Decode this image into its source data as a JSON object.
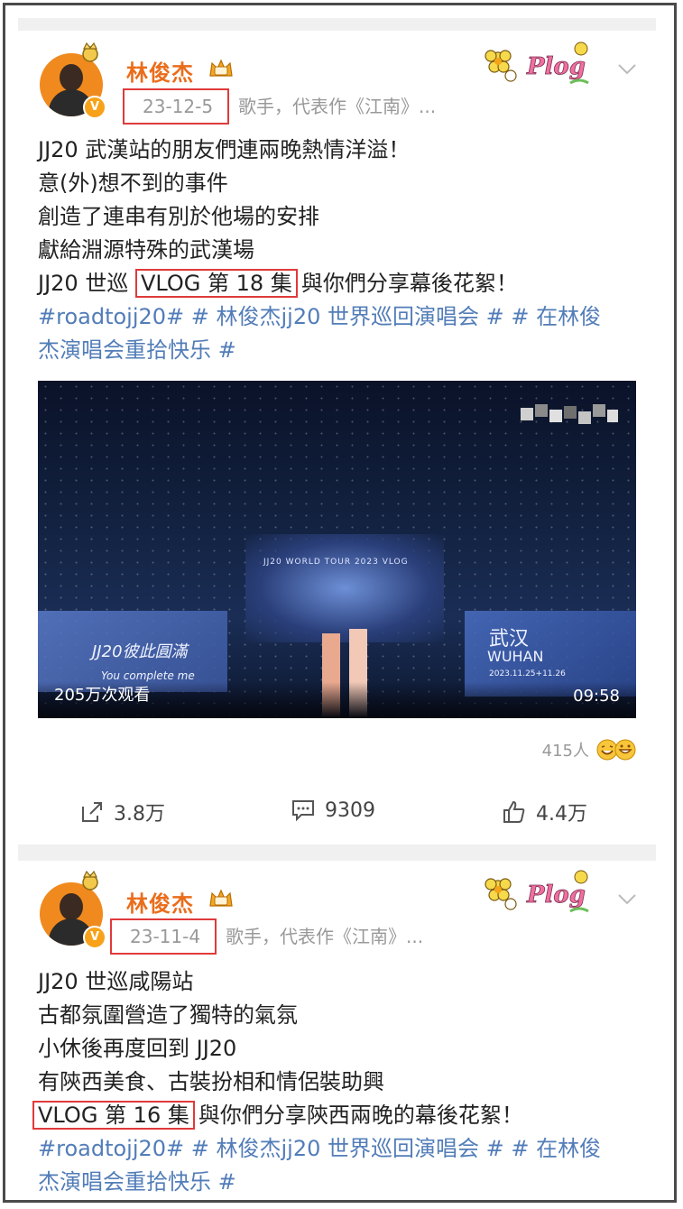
{
  "posts": [
    {
      "author": "林俊杰",
      "date": "23-12-5",
      "bio": "歌手，代表作《江南》...",
      "lines": [
        "JJ20 武漢站的朋友們連兩晚熱情洋溢！",
        "意(外)想不到的事件",
        "創造了連串有別於他場的安排",
        "獻給淵源特殊的武漢場"
      ],
      "vlog_prefix": "JJ20 世巡",
      "vlog_label": "VLOG 第 18 集",
      "vlog_suffix": "與你們分享幕後花絮！",
      "hashtags_line1": "#roadtojj20# # 林俊杰jj20 世界巡回演唱会 # # 在林俊",
      "hashtags_line2": "杰演唱会重拾快乐 #",
      "video": {
        "views": "205万次观看",
        "duration": "09:58",
        "stage_title": "JJ20 WORLD TOUR 2023 VLOG",
        "screen_left": "JJ20彼此圓滿",
        "screen_left_sub": "You complete me",
        "screen_right": "武汉",
        "screen_right_sub": "WUHAN",
        "screen_right_date": "2023.11.25+11.26"
      },
      "reactions_count": "415人",
      "share_count": "3.8万",
      "comment_count": "9309",
      "like_count": "4.4万"
    },
    {
      "author": "林俊杰",
      "date": "23-11-4",
      "bio": "歌手，代表作《江南》...",
      "lines": [
        "JJ20 世巡咸陽站",
        "古都氛圍營造了獨特的氣氛",
        "小休後再度回到 JJ20",
        "有陝西美食、古裝扮相和情侶裝助興"
      ],
      "vlog_label": "VLOG 第 16 集",
      "vlog_suffix": "與你們分享陝西兩晚的幕後花絮！",
      "hashtags_line1": "#roadtojj20# # 林俊杰jj20 世界巡回演唱会 # # 在林俊",
      "hashtags_line2": "杰演唱会重拾快乐 #"
    }
  ],
  "sticker_text": "Plog",
  "colors": {
    "name": "#ea6d1b",
    "hashtag": "#527db8",
    "highlight_box": "#e03a3a"
  }
}
